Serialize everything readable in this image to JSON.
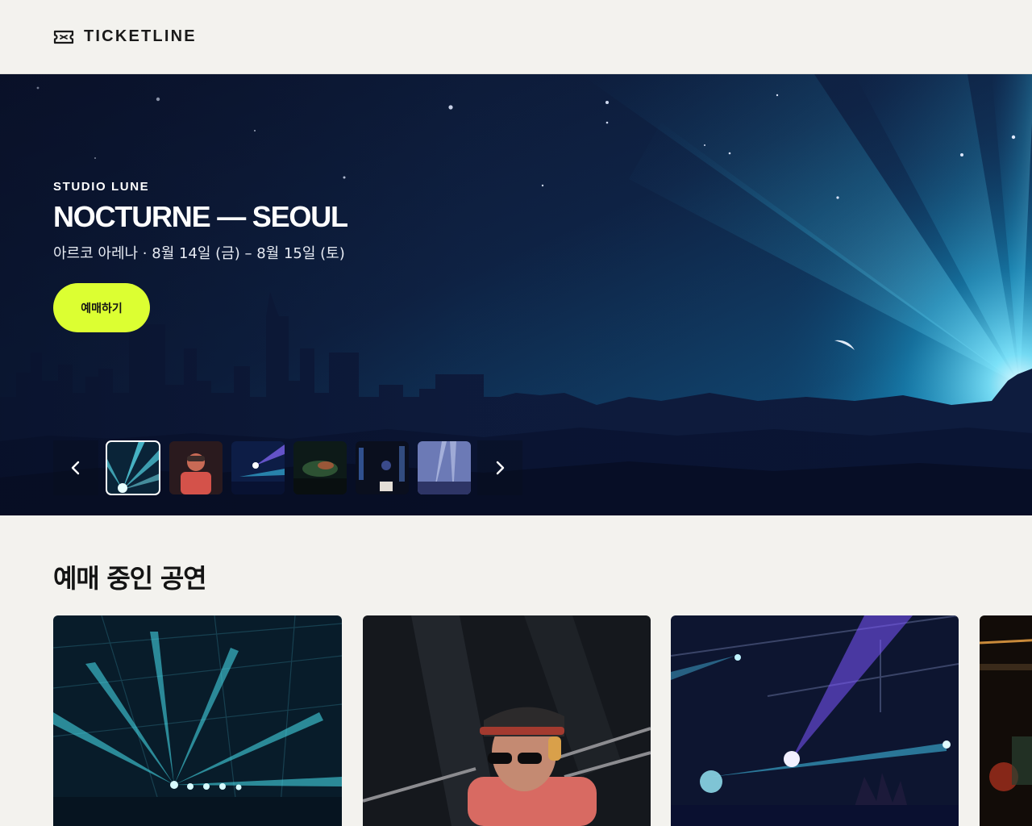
{
  "brand": {
    "name": "TICKETLINE",
    "icon": "ticket-icon"
  },
  "hero": {
    "eyebrow": "STUDIO LUNE",
    "title": "NOCTURNE — SEOUL",
    "subtitle": "아르코 아레나 · 8월 14일 (금) – 8월 15일 (토)",
    "cta_label": "예매하기",
    "accent_color": "#dcff32",
    "carousel": {
      "prev_icon": "chevron-left-icon",
      "next_icon": "chevron-right-icon",
      "active_index": 0,
      "thumbnails": [
        {
          "subject": "laser-show"
        },
        {
          "subject": "dj-performer"
        },
        {
          "subject": "stage-lights"
        },
        {
          "subject": "concert-crowd"
        },
        {
          "subject": "dj-booth"
        },
        {
          "subject": "hazy-stage"
        }
      ]
    }
  },
  "on_sale": {
    "title": "예매 중인 공연",
    "cards": [
      {
        "subject": "laser-show"
      },
      {
        "subject": "dj-performer"
      },
      {
        "subject": "purple-spotlights"
      },
      {
        "subject": "warm-stage"
      }
    ]
  }
}
